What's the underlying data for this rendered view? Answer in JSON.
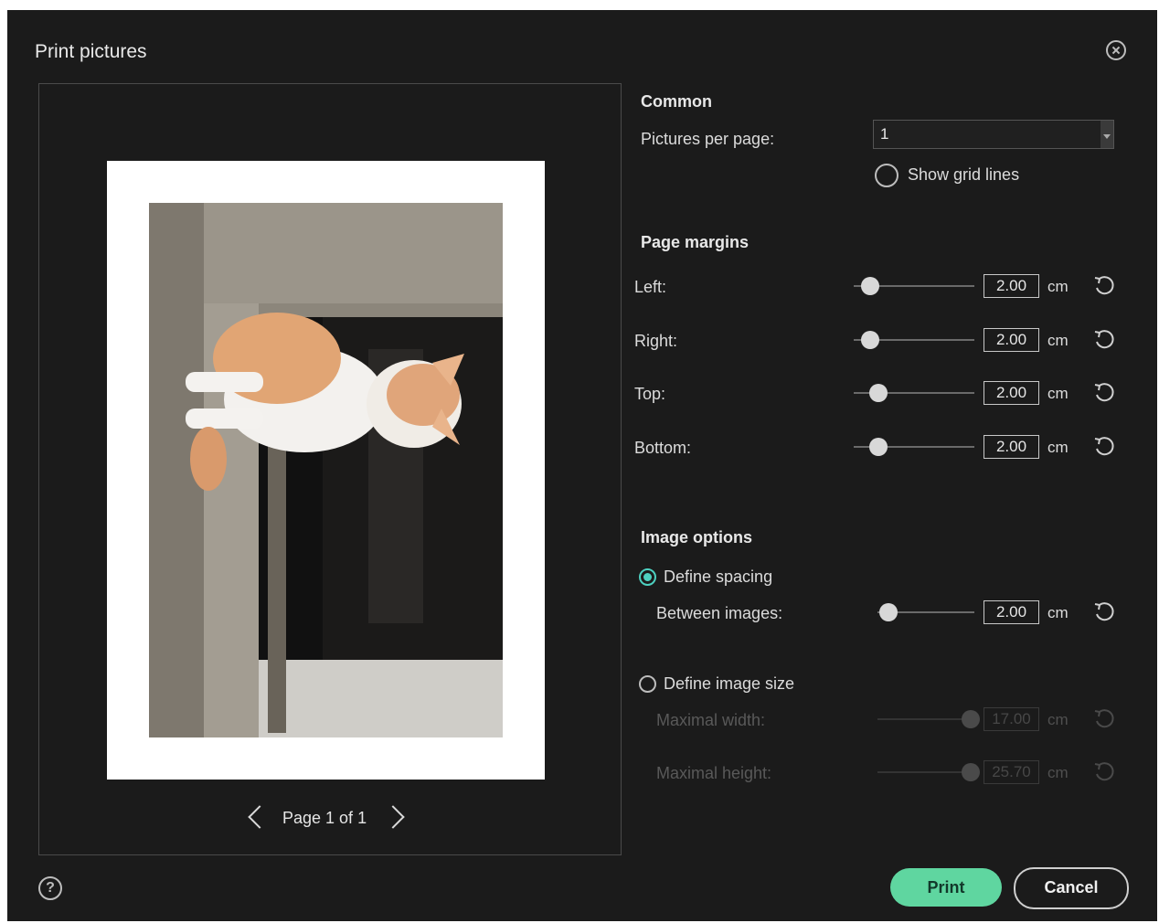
{
  "dialog": {
    "title": "Print pictures",
    "close_icon": "close-circle-icon",
    "help_icon": "help-circle-icon"
  },
  "preview": {
    "page_label": "Page 1 of 1",
    "prev_icon": "chevron-left-icon",
    "next_icon": "chevron-right-icon"
  },
  "common": {
    "heading": "Common",
    "pictures_per_page_label": "Pictures per page:",
    "pictures_per_page_value": "1",
    "show_grid_lines_label": "Show grid lines"
  },
  "margins": {
    "heading": "Page margins",
    "unit": "cm",
    "items": [
      {
        "label": "Left:",
        "value": "2.00"
      },
      {
        "label": "Right:",
        "value": "2.00"
      },
      {
        "label": "Top:",
        "value": "2.00"
      },
      {
        "label": "Bottom:",
        "value": "2.00"
      }
    ]
  },
  "image_options": {
    "heading": "Image options",
    "define_spacing_label": "Define spacing",
    "between_images_label": "Between images:",
    "between_images_value": "2.00",
    "define_size_label": "Define image size",
    "max_width_label": "Maximal width:",
    "max_width_value": "17.00",
    "max_height_label": "Maximal height:",
    "max_height_value": "25.70",
    "unit": "cm"
  },
  "buttons": {
    "print": "Print",
    "cancel": "Cancel"
  },
  "colors": {
    "background": "#1b1b1b",
    "accent": "#4dd0c0",
    "print_button": "#5fd6a0"
  }
}
